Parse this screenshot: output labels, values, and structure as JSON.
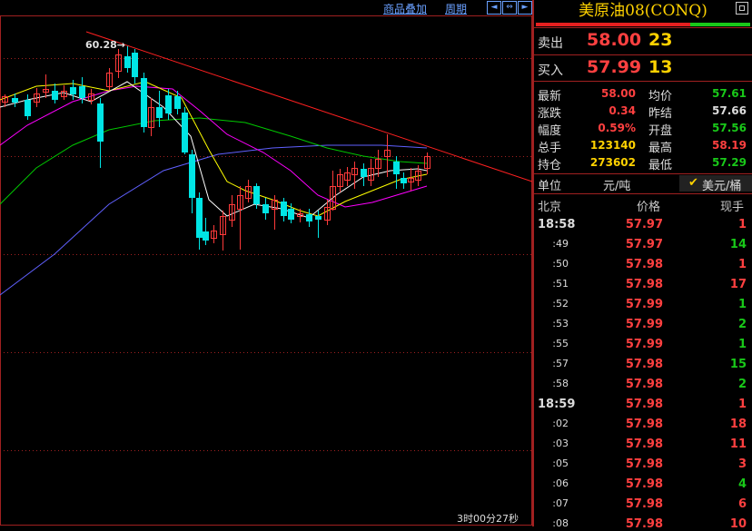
{
  "chart": {
    "toolbar": {
      "overlay_label": "商品叠加",
      "period_label": "周期"
    },
    "high_annotation": "60.28→",
    "countdown": "3时00分27秒",
    "colors": {
      "up": "#ff3a3a",
      "down": "#00e5e5",
      "ma5": "#ffffff",
      "ma10": "#ffff00",
      "ma20": "#ff00ff",
      "ma40": "#00c800",
      "ma60": "#6060ff",
      "trend": "#ff2020"
    }
  },
  "panel": {
    "title": "美原油08(CONQ)",
    "quote": {
      "sell_label": "卖出",
      "sell_price": "58.00",
      "sell_vol": "23",
      "buy_label": "买入",
      "buy_price": "57.99",
      "buy_vol": "13"
    },
    "stats": [
      {
        "l": "最新",
        "v": "58.00",
        "l2": "均价",
        "v2": "57.61"
      },
      {
        "l": "涨跌",
        "v": "0.34",
        "l2": "昨结",
        "v2": "57.66"
      },
      {
        "l": "幅度",
        "v": "0.59%",
        "l2": "开盘",
        "v2": "57.56"
      },
      {
        "l": "总手",
        "v": "123140",
        "l2": "最高",
        "v2": "58.19"
      },
      {
        "l": "持仓",
        "v": "273602",
        "l2": "最低",
        "v2": "57.29"
      }
    ],
    "unit": {
      "label": "单位",
      "ton": "元/吨",
      "barrel": "美元/桶"
    },
    "ticks_header": {
      "time": "北京",
      "price": "价格",
      "vol": "现手"
    },
    "ticks": [
      {
        "t": "18:58",
        "p": "57.97",
        "v": "1",
        "big": true
      },
      {
        "t": ":49",
        "p": "57.97",
        "v": "14"
      },
      {
        "t": ":50",
        "p": "57.98",
        "v": "1"
      },
      {
        "t": ":51",
        "p": "57.98",
        "v": "17"
      },
      {
        "t": ":52",
        "p": "57.99",
        "v": "1"
      },
      {
        "t": ":53",
        "p": "57.99",
        "v": "2"
      },
      {
        "t": ":55",
        "p": "57.99",
        "v": "1"
      },
      {
        "t": ":57",
        "p": "57.98",
        "v": "15"
      },
      {
        "t": ":58",
        "p": "57.98",
        "v": "2"
      },
      {
        "t": "18:59",
        "p": "57.98",
        "v": "1",
        "big": true
      },
      {
        "t": ":02",
        "p": "57.98",
        "v": "18"
      },
      {
        "t": ":03",
        "p": "57.98",
        "v": "11"
      },
      {
        "t": ":05",
        "p": "57.98",
        "v": "3"
      },
      {
        "t": ":06",
        "p": "57.98",
        "v": "4"
      },
      {
        "t": ":07",
        "p": "57.98",
        "v": "6"
      },
      {
        "t": ":08",
        "p": "57.98",
        "v": "10"
      }
    ],
    "vol_colors": [
      "red",
      "green",
      "red",
      "red",
      "green",
      "green",
      "green",
      "green",
      "green",
      "red",
      "red",
      "red",
      "red",
      "green",
      "red",
      "red"
    ]
  }
}
